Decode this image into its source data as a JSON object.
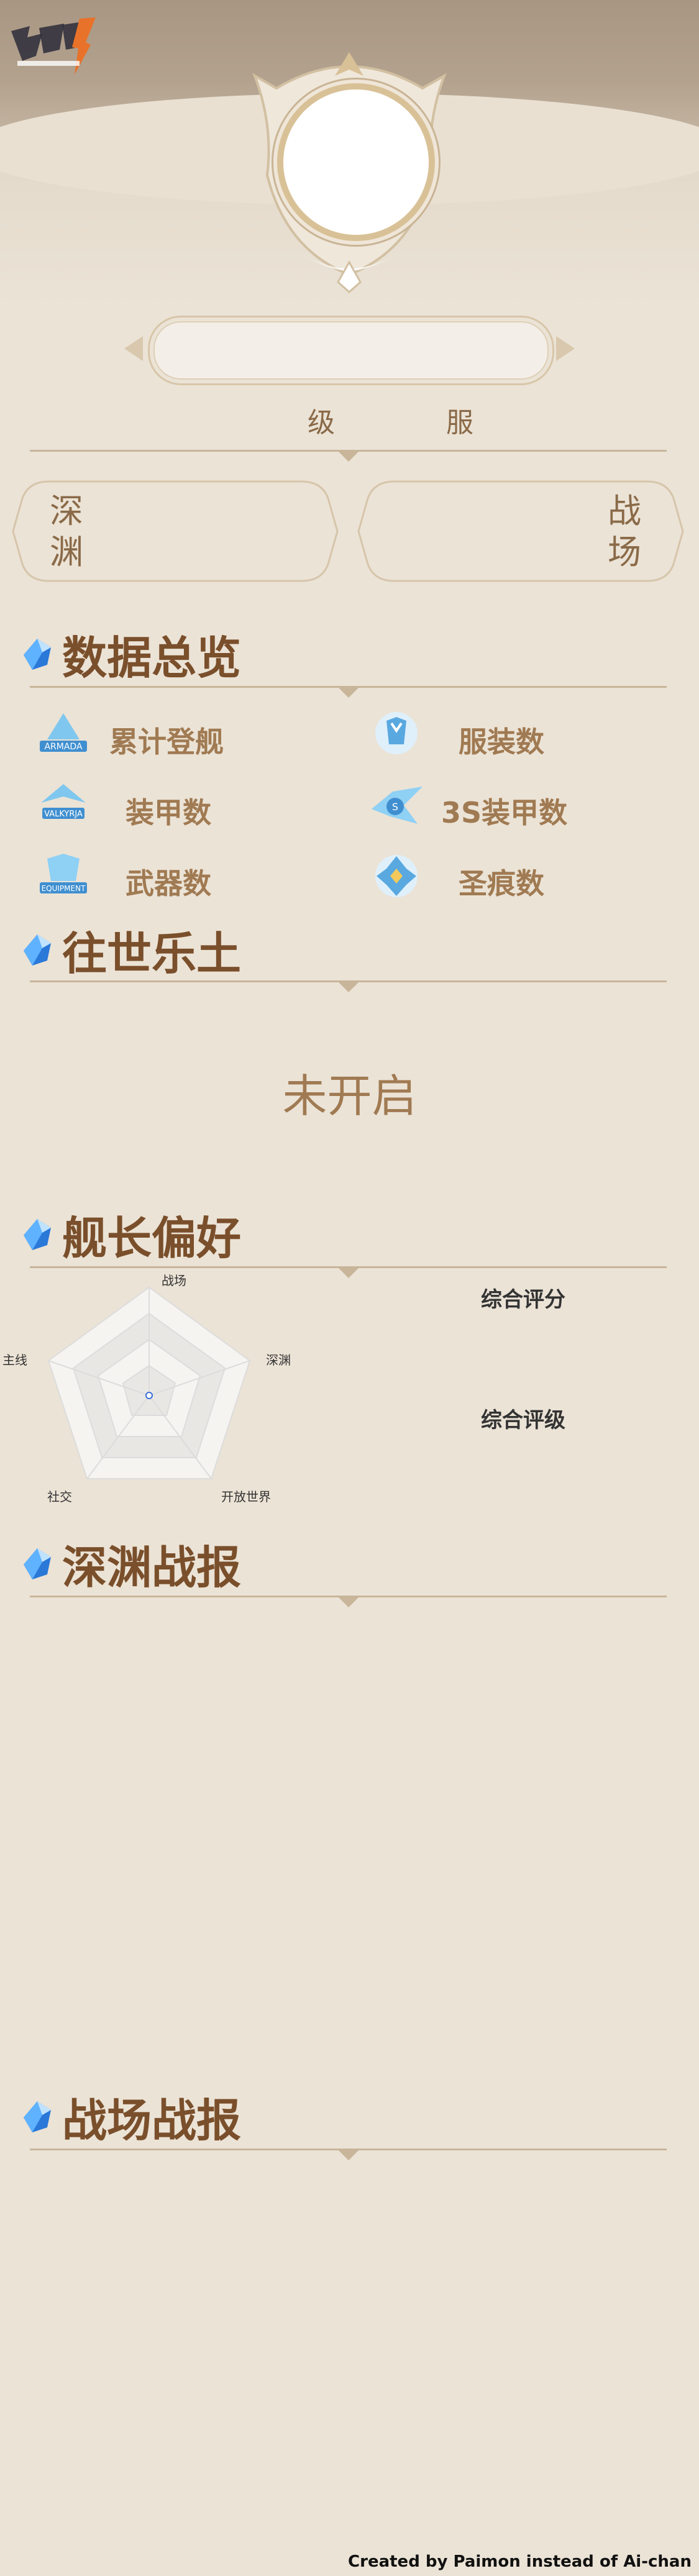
{
  "profile": {
    "level_label": "级",
    "server_label": "服",
    "abyss_label": "深渊",
    "battlefield_label": "战场"
  },
  "overview": {
    "title": "数据总览",
    "items": [
      {
        "label": "累计登舰",
        "icon": "armada-icon"
      },
      {
        "label": "服装数",
        "icon": "outfit-icon"
      },
      {
        "label": "装甲数",
        "icon": "valkyrja-icon"
      },
      {
        "label": "3S装甲数",
        "icon": "s-rank-valkyrja-icon"
      },
      {
        "label": "武器数",
        "icon": "equipment-icon"
      },
      {
        "label": "圣痕数",
        "icon": "stigmata-icon"
      }
    ]
  },
  "elysian": {
    "title": "往世乐土",
    "status": "未开启"
  },
  "preference": {
    "title": "舰长偏好",
    "radar_axes": [
      "战场",
      "深渊",
      "开放世界",
      "社交",
      "主线"
    ],
    "overall_score_label": "综合评分",
    "overall_grade_label": "综合评级"
  },
  "abyss_report": {
    "title": "深渊战报"
  },
  "battlefield_report": {
    "title": "战场战报"
  },
  "footer": {
    "credit": "Created by Paimon instead of Ai-chan"
  },
  "colors": {
    "background": "#ebe3d6",
    "title_brown": "#7a4f2b",
    "label_brown": "#a07a52",
    "rule": "#c8b59a",
    "gem_blue": "#2a78d8"
  }
}
